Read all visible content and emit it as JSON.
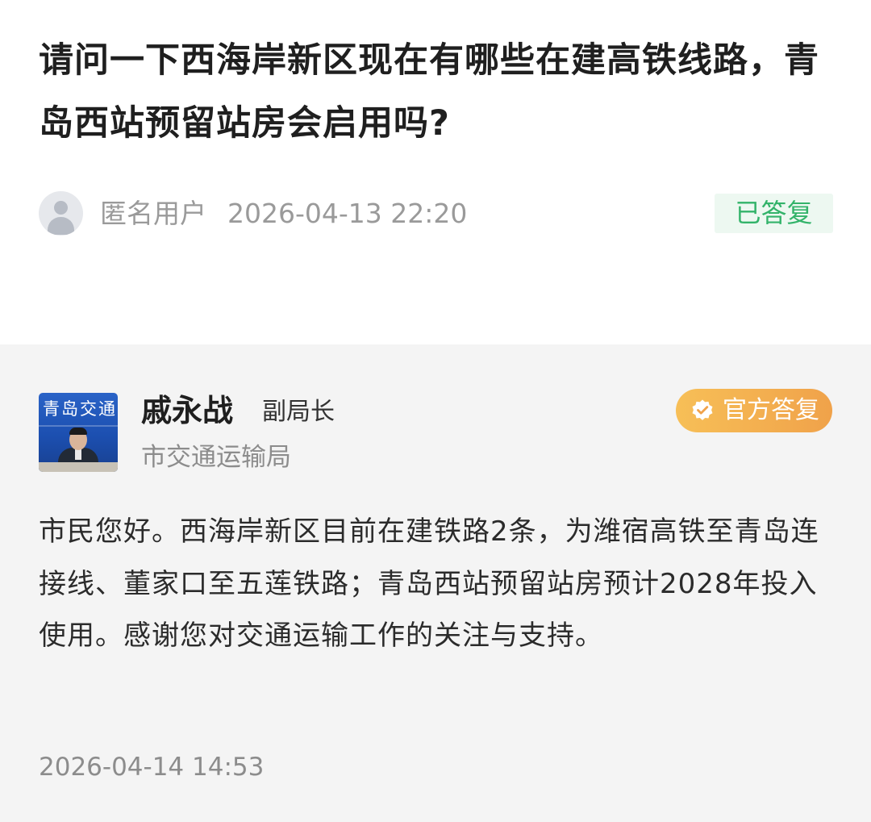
{
  "question": {
    "title": "请问一下西海岸新区现在有哪些在建高铁线路，青岛西站预留站房会启用吗?",
    "asker_name": "匿名用户",
    "time": "2026-04-13 22:20",
    "status": "已答复",
    "status_color": "#33b36a",
    "avatar_icon": "user-placeholder-icon"
  },
  "answer": {
    "official_name": "戚永战",
    "official_title": "副局长",
    "department": "市交通运输局",
    "badge_label": "官方答复",
    "badge_icon": "verified-check-icon",
    "badge_color": "#f0a24a",
    "avatar_caption": "青岛交通",
    "text": "市民您好。西海岸新区目前在建铁路2条，为潍宿高铁至青岛连接线、董家口至五莲铁路；青岛西站预留站房预计2028年投入使用。感谢您对交通运输工作的关注与支持。",
    "time": "2026-04-14 14:53"
  }
}
